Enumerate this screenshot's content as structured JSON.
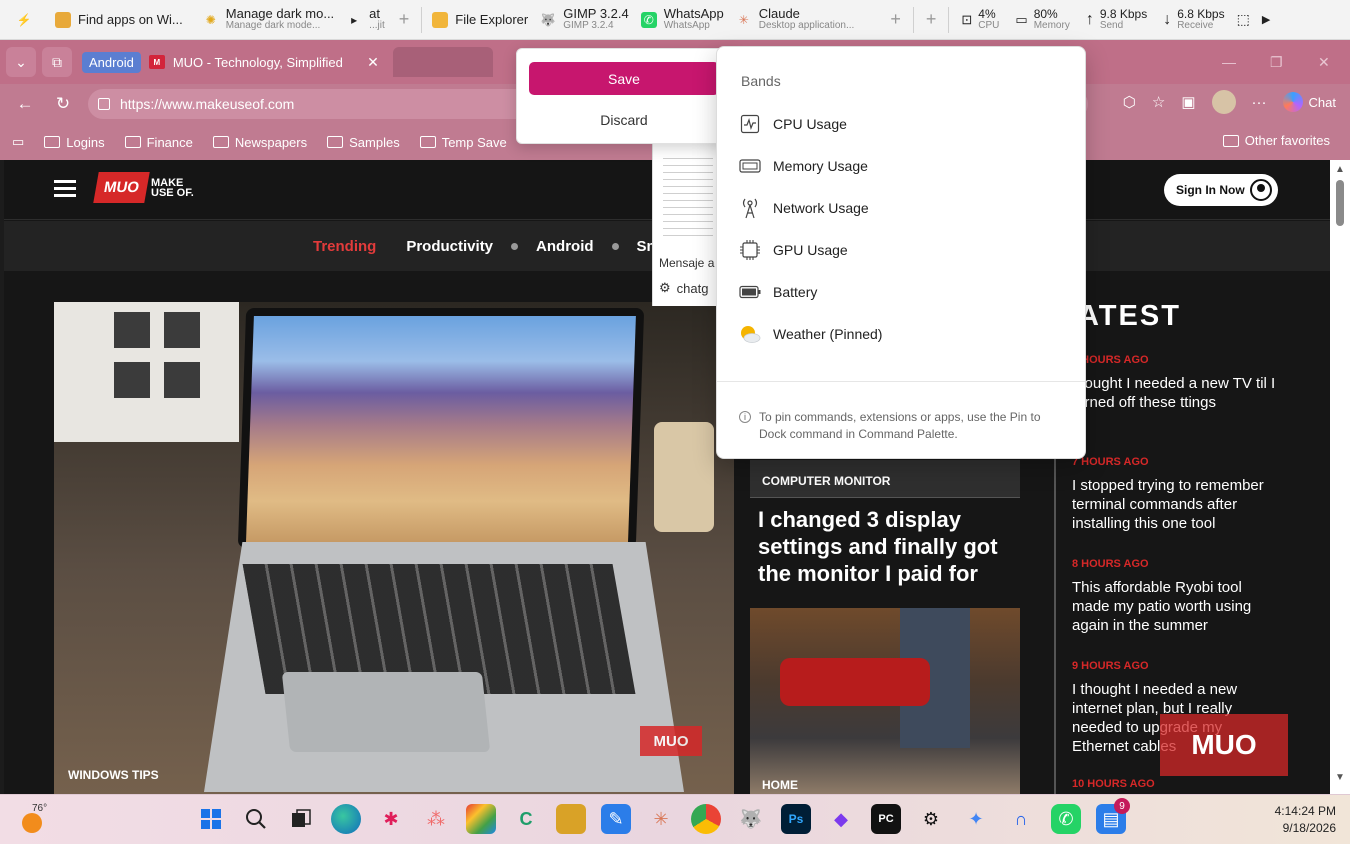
{
  "dock": {
    "apps": [
      {
        "name": "Find apps on Wi...",
        "sub": "",
        "icon": "puzzle-icon"
      },
      {
        "name": "Manage dark mo...",
        "sub": "Manage dark mode...",
        "icon": "sun-icon"
      },
      {
        "name": "at",
        "sub": "...jit",
        "icon": "play-icon"
      }
    ],
    "pinned": [
      {
        "name": "File Explorer",
        "sub": "",
        "icon": "folder-icon"
      },
      {
        "name": "GIMP 3.2.4",
        "sub": "GIMP 3.2.4",
        "icon": "gimp-icon"
      },
      {
        "name": "WhatsApp",
        "sub": "WhatsApp",
        "icon": "whatsapp-icon"
      },
      {
        "name": "Claude",
        "sub": "Desktop application...",
        "icon": "claude-icon"
      }
    ],
    "stats": [
      {
        "value": "4%",
        "label": "CPU"
      },
      {
        "value": "80%",
        "label": "Memory"
      },
      {
        "value": "9.8 Kbps",
        "label": "Send"
      },
      {
        "value": "6.8 Kbps",
        "label": "Receive"
      }
    ]
  },
  "browser": {
    "profile_pill": "Android",
    "active_tab": "MUO - Technology, Simplified",
    "url": "https://www.makeuseof.com",
    "chat_label": "Chat",
    "favorites": [
      "Logins",
      "Finance",
      "Newspapers",
      "Samples",
      "Temp Save"
    ],
    "other_favorites": "Other favorites"
  },
  "site": {
    "logo_mark": "MUO",
    "logo_text": "MAKE USE OF.",
    "signin": "Sign In Now",
    "nav": [
      "Trending",
      "Productivity",
      "Android",
      "Smart T"
    ],
    "hero_label": "WINDOWS TIPS",
    "hero_watermark": "MUO",
    "feature_category": "COMPUTER MONITOR",
    "feature_title": "I changed 3 display settings and finally got the monitor I paid for",
    "feature2_category": "HOME",
    "latest_heading": "ATEST",
    "latest": [
      {
        "time": "5 HOURS AGO",
        "title": "thought I needed a new TV til I turned off these ttings"
      },
      {
        "time": "7 HOURS AGO",
        "title": "I stopped trying to remember terminal commands after installing this one tool"
      },
      {
        "time": "8 HOURS AGO",
        "title": "This affordable Ryobi tool made my patio worth using again in the summer"
      },
      {
        "time": "9 HOURS AGO",
        "title": "I thought I needed a new internet plan, but I really needed to upgrade my Ethernet cables"
      },
      {
        "time": "10 HOURS AGO",
        "title": ""
      }
    ],
    "latest_watermark": "MUO"
  },
  "save_popover": {
    "save": "Save",
    "discard": "Discard"
  },
  "chat_window": {
    "label": "Mensaje a",
    "row": "chatg"
  },
  "bands": {
    "header": "Bands",
    "items": [
      {
        "label": "CPU Usage",
        "icon": "cpu-chart-icon"
      },
      {
        "label": "Memory Usage",
        "icon": "memory-icon"
      },
      {
        "label": "Network Usage",
        "icon": "antenna-icon"
      },
      {
        "label": "GPU Usage",
        "icon": "gpu-chip-icon"
      },
      {
        "label": "Battery",
        "icon": "battery-icon"
      },
      {
        "label": "Weather (Pinned)",
        "icon": "weather-icon"
      }
    ],
    "hint": "To pin commands, extensions or apps, use the Pin to Dock command in Command Palette."
  },
  "taskbar": {
    "temperature": "76°",
    "whatsapp_badge": "9",
    "time": "4:14:24 PM",
    "date": "9/18/2026"
  },
  "colors": {
    "accent": "#c7166e",
    "browser_chrome": "#bf6f88",
    "muo_red": "#d62828",
    "trending": "#e23b3b"
  }
}
